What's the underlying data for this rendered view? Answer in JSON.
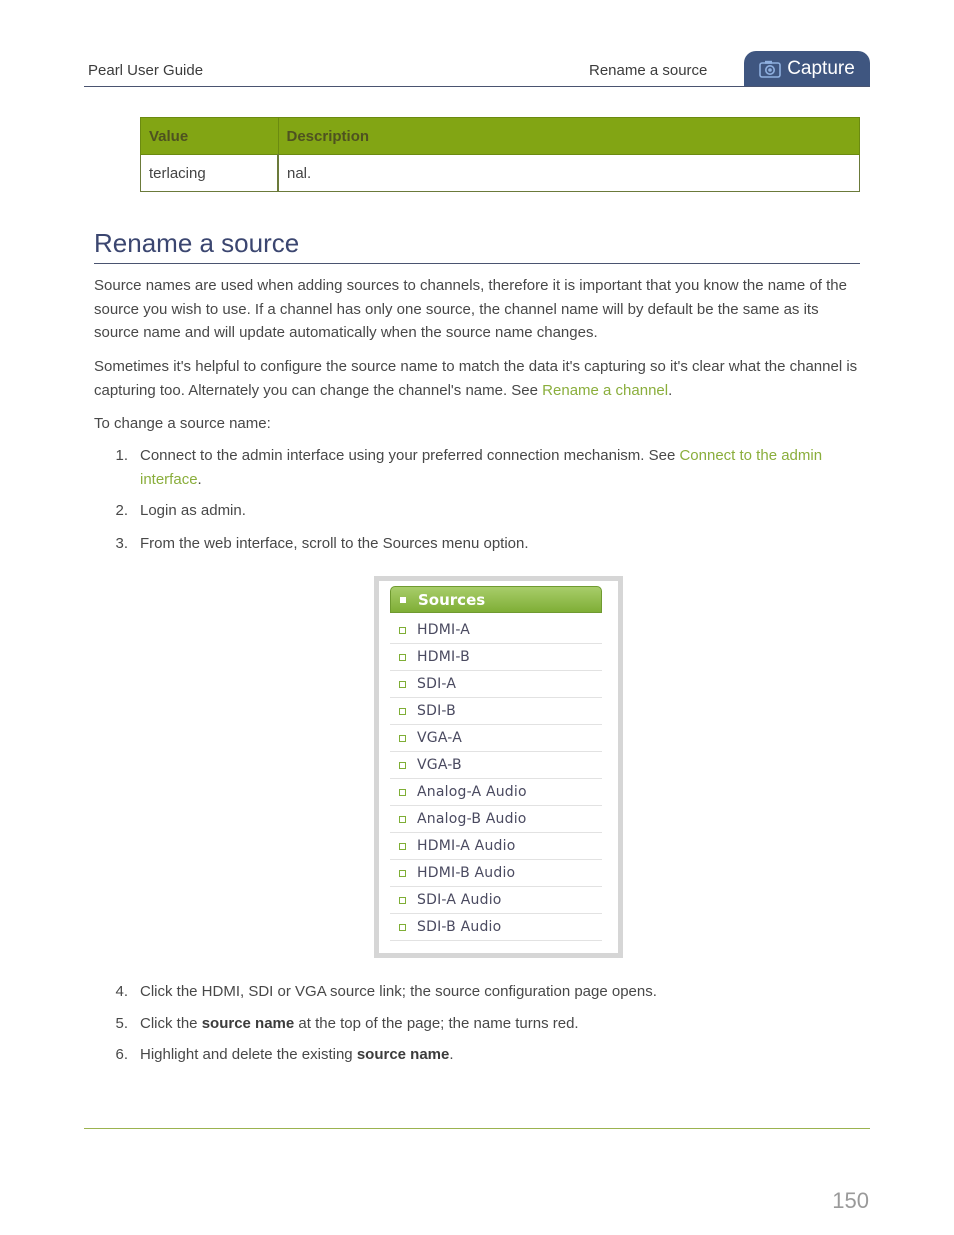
{
  "header": {
    "doc_title": "Pearl User Guide",
    "section": "Rename a source",
    "tab_label": "Capture",
    "tab_icon": "camera-icon",
    "tab_color": "#3f5680"
  },
  "table": {
    "headers": [
      "Value",
      "Description"
    ],
    "rows": [
      [
        "terlacing",
        "nal."
      ]
    ],
    "header_color": "#82a514"
  },
  "section": {
    "title": "Rename a source",
    "para1": "Source names are used when adding sources to channels, therefore it is important that you know the name of the source you wish to use.  If a channel has only one source, the channel name will by default be the same as its source name and will update automatically when the source name changes.",
    "para2_text": "Sometimes it's helpful to configure the source name to match the data it's capturing so it's clear what the channel is capturing too. Alternately you can change the channel's name. See ",
    "para2_link": "Rename a channel",
    "para2_end": ".",
    "para3": "To change a source name:",
    "link_color": "#8aae3c"
  },
  "steps_a": [
    {
      "num": "1.",
      "text": "Connect to the admin interface using your preferred connection mechanism. See ",
      "link": "Connect to the admin interface",
      "end": "."
    },
    {
      "num": "2.",
      "text": "Login as admin."
    },
    {
      "num": "3.",
      "text": "From the web interface, scroll to the Sources menu option."
    }
  ],
  "sources_menu": {
    "title": "Sources",
    "items": [
      "HDMI-A",
      "HDMI-B",
      "SDI-A",
      "SDI-B",
      "VGA-A",
      "VGA-B",
      "Analog-A Audio",
      "Analog-B Audio",
      "HDMI-A Audio",
      "HDMI-B Audio",
      "SDI-A Audio",
      "SDI-B Audio"
    ]
  },
  "steps_b": [
    {
      "num": "4.",
      "text": "Click the HDMI, SDI or VGA source link; the source configuration page opens."
    },
    {
      "num": "5.",
      "pre": "Click the ",
      "bold": "source name",
      "post": " at the top of the page; the name turns red."
    },
    {
      "num": "6.",
      "pre": "Highlight and delete the existing ",
      "bold": "source name",
      "post": "."
    }
  ],
  "footer": {
    "page_number": "150"
  }
}
